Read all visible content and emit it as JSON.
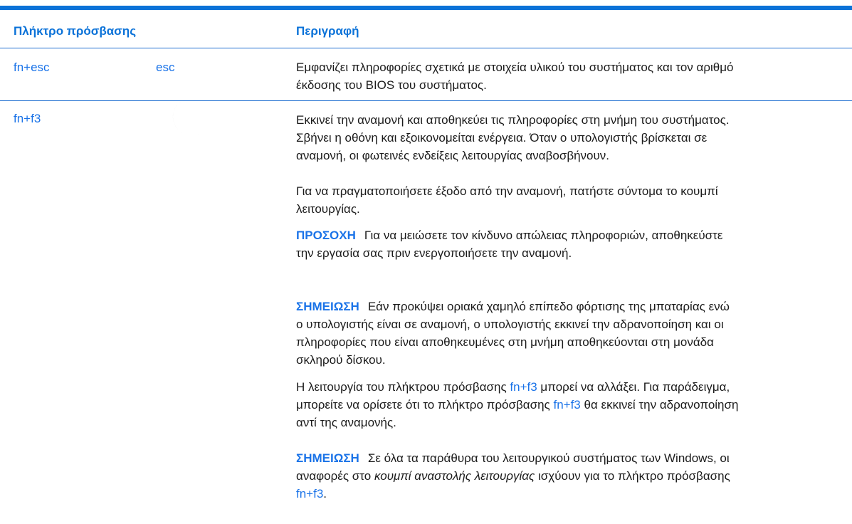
{
  "header": {
    "col1": "Πλήκτρο πρόσβασης",
    "col2": "Περιγραφή"
  },
  "row1": {
    "hotkey": "fn+esc",
    "icon_key": "esc",
    "desc_line1": "Εμφανίζει πληροφορίες σχετικά με στοιχεία υλικού του συστήματος και τον αριθμό",
    "desc_line2": "έκδοσης του BIOS του συστήματος."
  },
  "row2": {
    "hotkey": "fn+f3",
    "icon": "moon-icon",
    "p1": [
      "Εκκινεί την αναμονή και αποθηκεύει τις πληροφορίες στη μνήμη του συστήματος.",
      "Σβήνει η οθόνη και εξοικονομείται ενέργεια. Όταν ο υπολογιστής βρίσκεται σε",
      "αναμονή, οι φωτεινές ενδείξεις λειτουργίας αναβοσβήνουν."
    ],
    "p2": [
      "Για να πραγματοποιήσετε έξοδο από την αναμονή, πατήστε σύντομα το κουμπί",
      "λειτουργίας."
    ],
    "caution": {
      "label": "ΠΡΟΣΟΧΗ",
      "line1": "Για να μειώσετε τον κίνδυνο απώλειας πληροφοριών, αποθηκεύστε",
      "line2": "την εργασία σας πριν ενεργοποιήσετε την αναμονή."
    },
    "note1": {
      "label": "ΣΗΜΕΙΩΣΗ",
      "line1": "Εάν προκύψει οριακά χαμηλό επίπεδο φόρτισης της μπαταρίας ενώ",
      "line2": "ο υπολογιστής είναι σε αναμονή, ο υπολογιστής εκκινεί την αδρανοποίηση και οι",
      "line3": "πληροφορίες που είναι αποθηκευμένες στη μνήμη αποθηκεύονται στη μονάδα",
      "line4": "σκληρού δίσκου."
    },
    "p3": {
      "l1_a": "Η λειτουργία του πλήκτρου πρόσβασης ",
      "l1_link": "fn+f3",
      "l1_b": " μπορεί να αλλάξει. Για παράδειγμα,",
      "l2_a": "μπορείτε να ορίσετε ότι το πλήκτρο πρόσβασης ",
      "l2_link": "fn+f3",
      "l2_b": " θα εκκινεί την αδρανοποίηση",
      "l3": "αντί της αναμονής."
    },
    "note2": {
      "label": "ΣΗΜΕΙΩΣΗ",
      "l1": "Σε όλα τα παράθυρα του λειτουργικού συστήματος των Windows, οι",
      "l2_a": "αναφορές στο ",
      "l2_italic": "κουμπί αναστολής λειτουργίας",
      "l2_b": " ισχύουν για το πλήκτρο πρόσβασης",
      "l3_link": "fn+f3",
      "l3_end": "."
    }
  }
}
